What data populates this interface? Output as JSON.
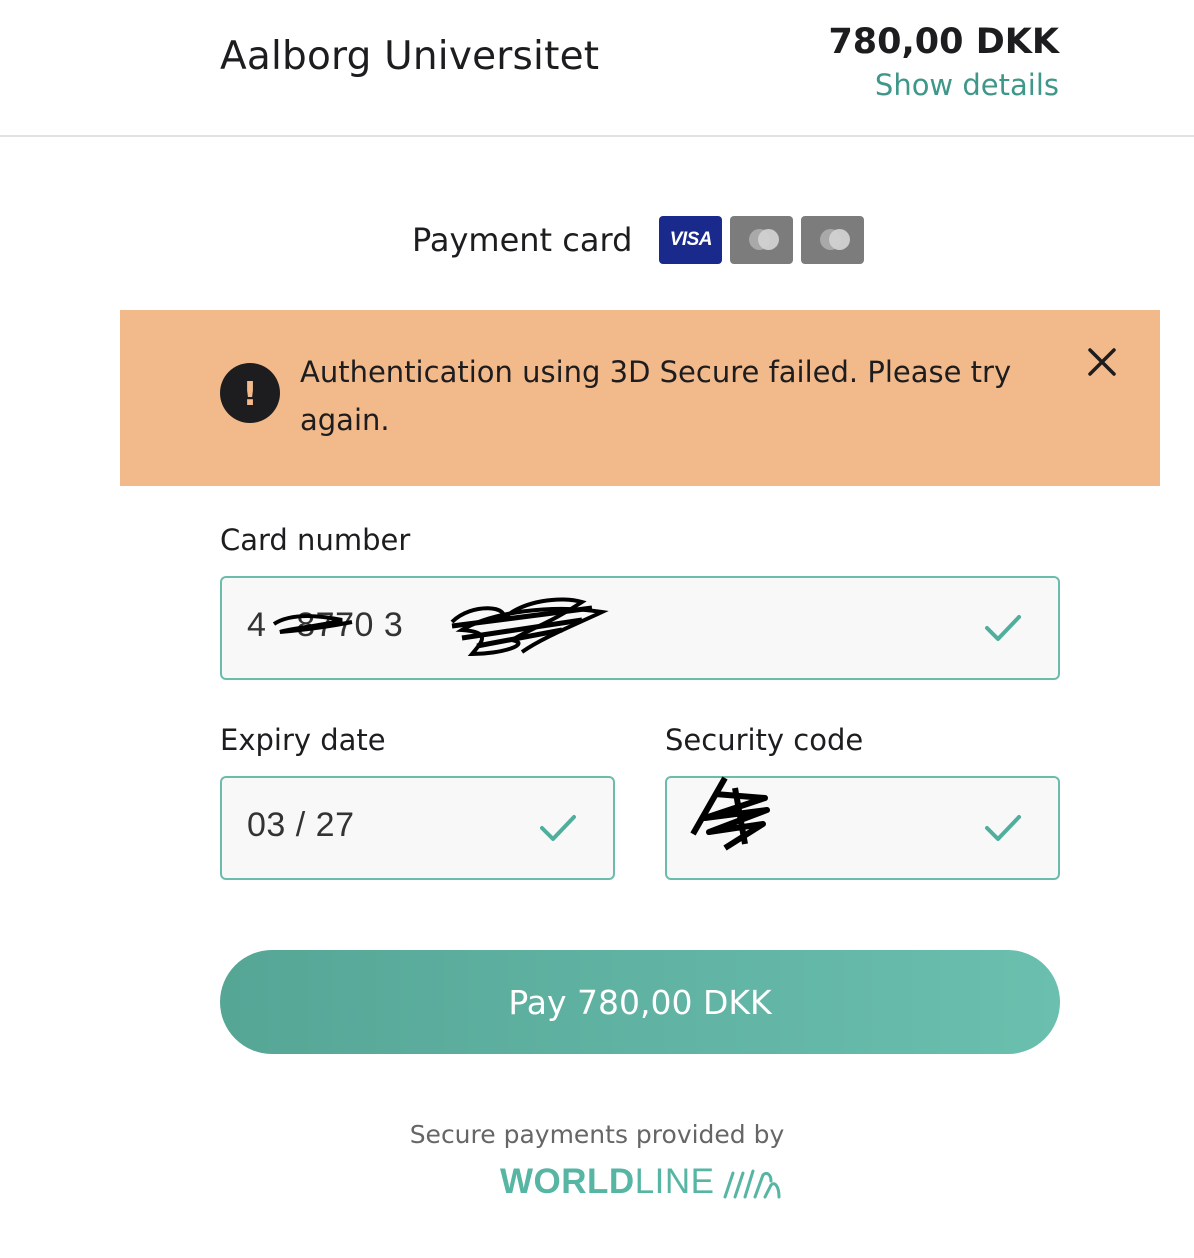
{
  "header": {
    "merchant": "Aalborg Universitet",
    "amount": "780,00 DKK",
    "details_link": "Show details"
  },
  "payment_method": {
    "label": "Payment card",
    "card_logos": [
      {
        "name": "visa-logo",
        "text": "VISA"
      },
      {
        "name": "mastercard-logo"
      },
      {
        "name": "maestro-logo"
      }
    ]
  },
  "alert": {
    "icon": "exclamation-icon",
    "message": "Authentication using 3D Secure failed. Please try again.",
    "close_icon": "close-icon"
  },
  "form": {
    "card_number_label": "Card number",
    "card_number_value": "4⁠ ⁠ ⁠ ⁠8770 3",
    "expiry_label": "Expiry date",
    "expiry_value": "03 / 27",
    "security_label": "Security code",
    "security_value": ""
  },
  "pay_button": "Pay 780,00 DKK",
  "footer": {
    "text": "Secure payments provided by",
    "brand_bold": "WORLD",
    "brand_light": "LINE"
  },
  "colors": {
    "accent": "#56a696",
    "alert_bg": "#f2b98a",
    "visa_blue": "#1a2a8c"
  }
}
